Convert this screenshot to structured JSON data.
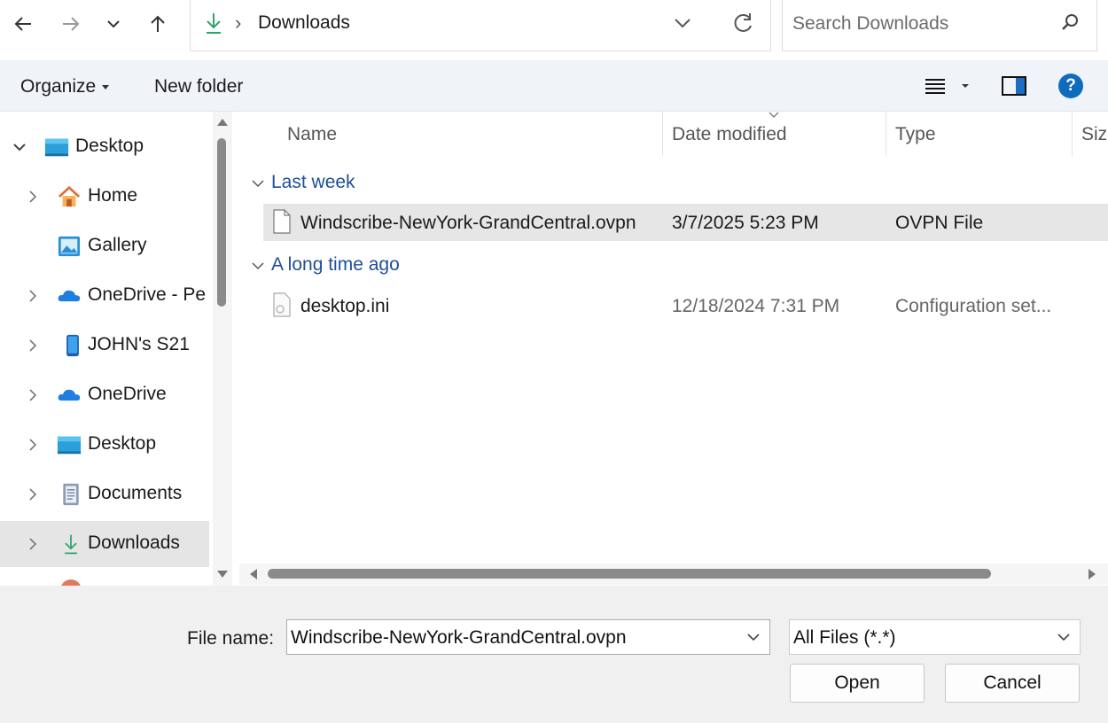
{
  "address": {
    "crumb": "Downloads"
  },
  "search": {
    "placeholder": "Search Downloads"
  },
  "commands": {
    "organize": "Organize",
    "new_folder": "New folder",
    "help": "?"
  },
  "nav": {
    "items": [
      {
        "label": "Desktop",
        "icon": "desktop-icon",
        "expander": "expanded"
      },
      {
        "label": "Home",
        "icon": "home-icon",
        "expander": "collapsed"
      },
      {
        "label": "Gallery",
        "icon": "gallery-icon",
        "expander": "none"
      },
      {
        "label": "OneDrive - Pe",
        "icon": "onedrive-icon",
        "expander": "collapsed"
      },
      {
        "label": "JOHN's S21",
        "icon": "phone-icon",
        "expander": "collapsed"
      },
      {
        "label": "OneDrive",
        "icon": "onedrive-icon",
        "expander": "collapsed"
      },
      {
        "label": "Desktop",
        "icon": "desktop-icon",
        "expander": "collapsed"
      },
      {
        "label": "Documents",
        "icon": "documents-icon",
        "expander": "collapsed"
      },
      {
        "label": "Downloads",
        "icon": "downloads-icon",
        "expander": "collapsed",
        "selected": true
      }
    ]
  },
  "list": {
    "columns": {
      "name": "Name",
      "date": "Date modified",
      "type": "Type",
      "size": "Size"
    },
    "groups": [
      {
        "label": "Last week",
        "files": [
          {
            "name": "Windscribe-NewYork-GrandCentral.ovpn",
            "date": "3/7/2025 5:23 PM",
            "type": "OVPN File",
            "selected": true
          }
        ]
      },
      {
        "label": "A long time ago",
        "files": [
          {
            "name": "desktop.ini",
            "date": "12/18/2024 7:31 PM",
            "type": "Configuration set...",
            "selected": false
          }
        ]
      }
    ]
  },
  "bottom": {
    "filename_label": "File name:",
    "filename_value": "Windscribe-NewYork-GrandCentral.ovpn",
    "filetype_value": "All Files (*.*)",
    "open_label": "Open",
    "cancel_label": "Cancel"
  },
  "colors": {
    "accent": "#0f6cbd",
    "group_header": "#1f4e9a",
    "command_bar_bg": "#f0f4f9",
    "selection_bg": "#e6e6e6"
  }
}
